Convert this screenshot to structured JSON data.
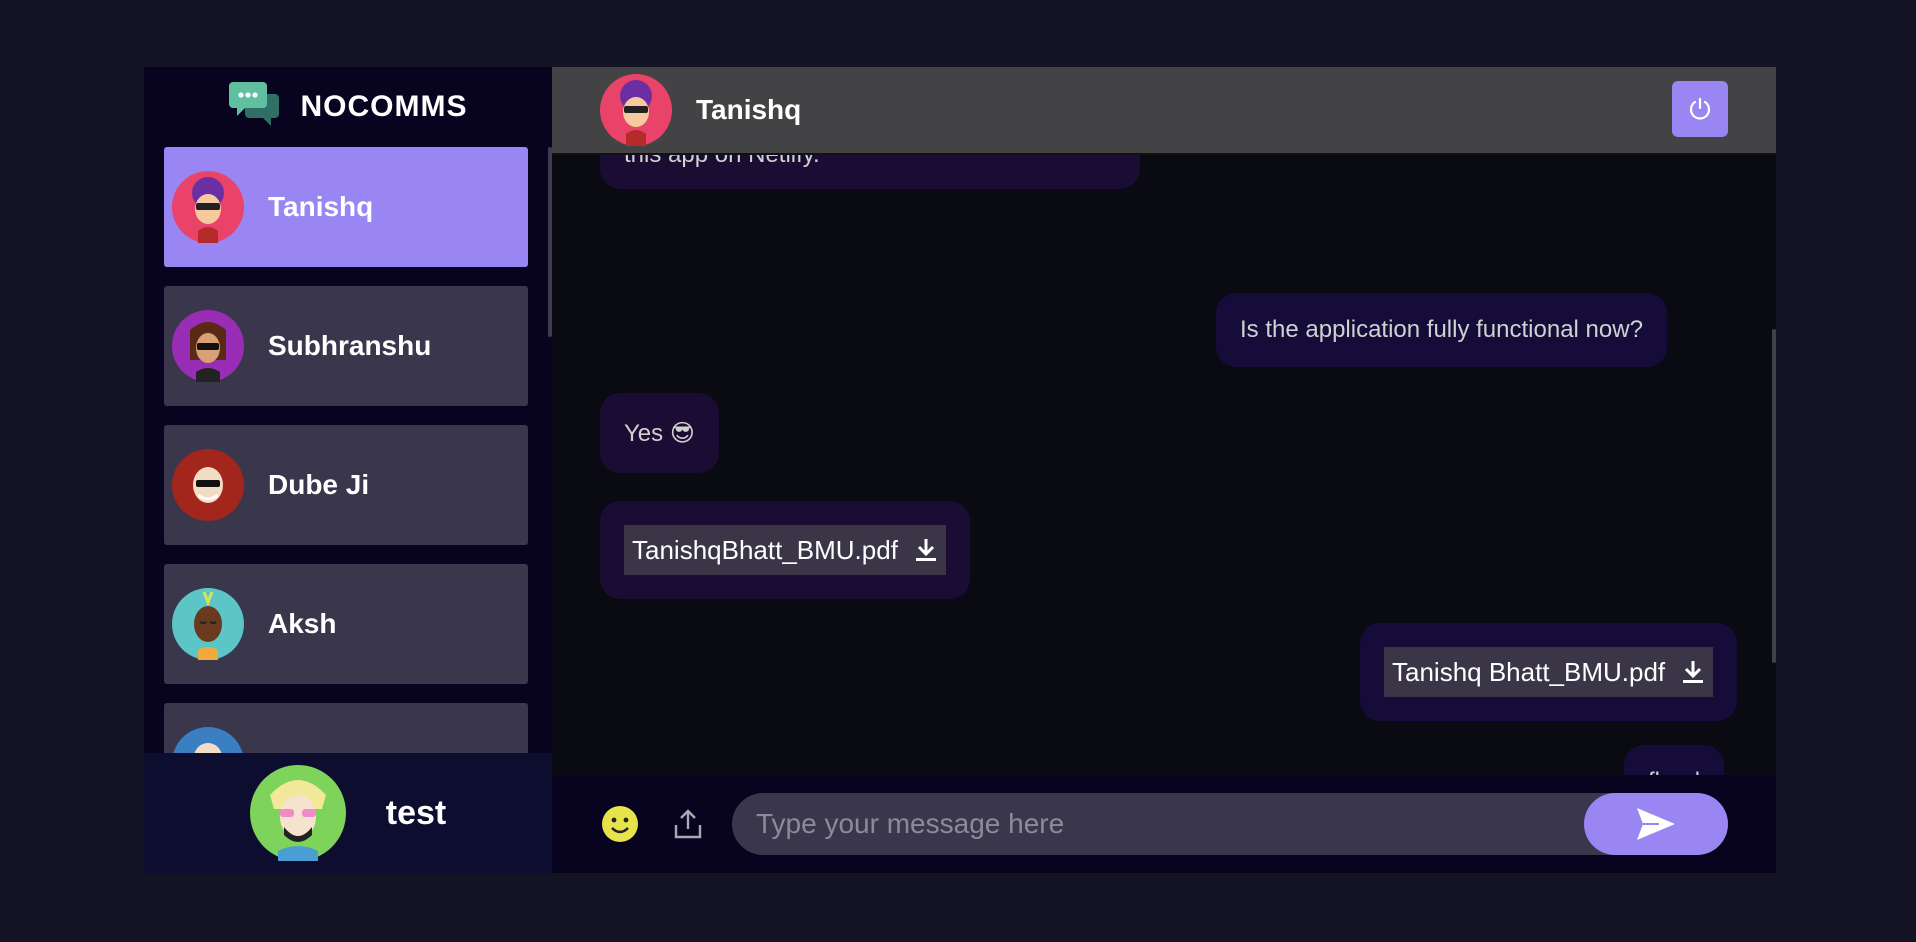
{
  "brand": {
    "name": "NOCOMMS"
  },
  "contacts": [
    {
      "name": "Tanishq"
    },
    {
      "name": "Subhranshu"
    },
    {
      "name": "Dube Ji"
    },
    {
      "name": "Aksh"
    }
  ],
  "current_user": {
    "name": "test"
  },
  "chat": {
    "contact_name": "Tanishq",
    "messages": [
      {
        "type": "received",
        "text": "this app on Netlify."
      },
      {
        "type": "sent",
        "text": "Is the application fully functional now?"
      },
      {
        "type": "received",
        "text": "Yes 😎"
      },
      {
        "type": "received",
        "file": "TanishqBhatt_BMU.pdf"
      },
      {
        "type": "sent",
        "file": "Tanishq Bhatt_BMU.pdf"
      },
      {
        "type": "sent",
        "text": "flood"
      }
    ],
    "input_placeholder": "Type your message here"
  },
  "colors": {
    "accent": "#9a86f3",
    "background": "#131324",
    "sidebar": "#080420"
  },
  "icons": [
    "chat-bubbles-icon",
    "power-icon",
    "emoji-icon",
    "upload-icon",
    "send-icon",
    "download-icon"
  ]
}
